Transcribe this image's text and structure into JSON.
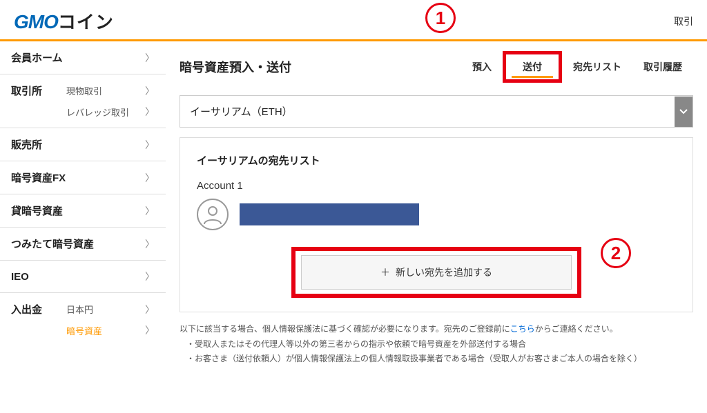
{
  "header": {
    "logo_gmo": "GMO",
    "logo_coin": "コイン",
    "right_link": "取引"
  },
  "sidebar": {
    "member_home": "会員ホーム",
    "exchange": "取引所",
    "exchange_spot": "現物取引",
    "exchange_leverage": "レバレッジ取引",
    "sales": "販売所",
    "crypto_fx": "暗号資産FX",
    "lending": "貸暗号資産",
    "tsumitate": "つみたて暗号資産",
    "ieo": "IEO",
    "deposit_withdraw": "入出金",
    "jpy": "日本円",
    "crypto_asset": "暗号資産"
  },
  "main": {
    "title": "暗号資産預入・送付",
    "tabs": {
      "deposit": "預入",
      "send": "送付",
      "dest_list": "宛先リスト",
      "history": "取引履歴"
    },
    "asset_selected": "イーサリアム（ETH）",
    "card_title": "イーサリアムの宛先リスト",
    "account_name": "Account 1",
    "add_button": "新しい宛先を追加する",
    "notice_main_a": "以下に該当する場合、個人情報保護法に基づく確認が必要になります。宛先のご登録前に",
    "notice_link": "こちら",
    "notice_main_b": "からご連絡ください。",
    "notice_bullet1": "・受取人またはその代理人等以外の第三者からの指示や依頼で暗号資産を外部送付する場合",
    "notice_bullet2": "・お客さま（送付依頼人）が個人情報保護法上の個人情報取扱事業者である場合（受取人がお客さまご本人の場合を除く）"
  },
  "callouts": {
    "one": "1",
    "two": "2"
  }
}
